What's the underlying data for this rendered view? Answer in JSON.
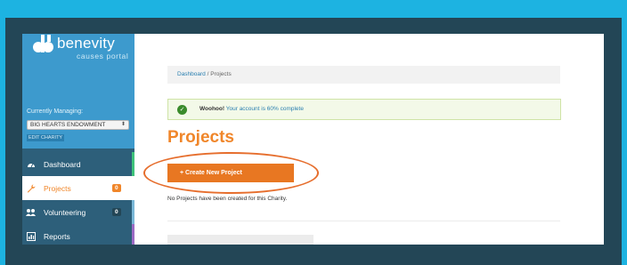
{
  "brand": {
    "name": "benevity",
    "tagline": "causes portal"
  },
  "sidebar": {
    "managing_label": "Currently Managing:",
    "selected_charity": "BIG HEARTS ENDOWMENT",
    "edit_charity": "EDIT CHARITY",
    "items": [
      {
        "label": "Dashboard",
        "icon": "dashboard-icon"
      },
      {
        "label": "Projects",
        "icon": "wrench-icon",
        "badge": "0",
        "active": true
      },
      {
        "label": "Volunteering",
        "icon": "users-icon",
        "badge": "0"
      },
      {
        "label": "Reports",
        "icon": "chart-icon"
      }
    ]
  },
  "breadcrumb": {
    "root": "Dashboard",
    "separator": " / ",
    "current": "Projects"
  },
  "alert": {
    "strong": "Woohoo!",
    "message": "Your account is 60% complete"
  },
  "page": {
    "title": "Projects",
    "create_button": "+ Create New Project",
    "empty_message": "No Projects have been created for this Charity."
  },
  "colors": {
    "accent": "#f0862a",
    "sidebar": "#2d5f7a",
    "brand_blue": "#3d9acd",
    "annotation": "#e66e2d"
  }
}
